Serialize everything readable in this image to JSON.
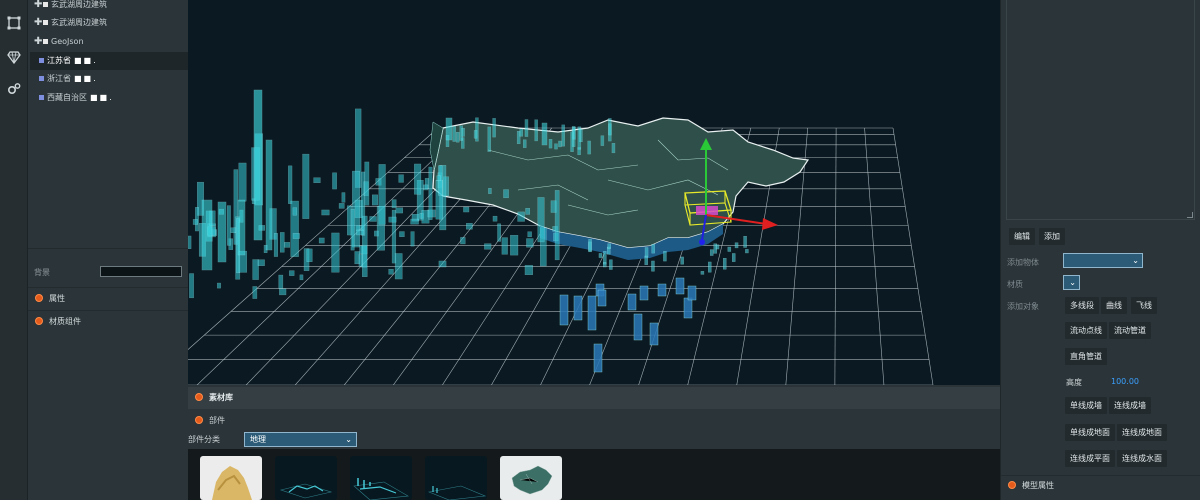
{
  "tree": {
    "items": [
      {
        "label": "玄武湖周边建筑",
        "expandable": true,
        "selected": false,
        "kind": "white"
      },
      {
        "label": "玄武湖周边建筑",
        "expandable": true,
        "selected": false,
        "kind": "white"
      },
      {
        "label": "GeoJson",
        "expandable": true,
        "selected": false,
        "kind": "white"
      },
      {
        "label": "江苏省",
        "expandable": false,
        "selected": true,
        "kind": "blue"
      },
      {
        "label": "浙江省",
        "expandable": false,
        "selected": false,
        "kind": "blue"
      },
      {
        "label": "西藏自治区",
        "expandable": false,
        "selected": false,
        "kind": "blue"
      }
    ]
  },
  "props": {
    "background_label": "背景",
    "background_color": "#0c1418",
    "sections": [
      "属性",
      "材质组件"
    ]
  },
  "library": {
    "title": "素材库",
    "parts_label": "部件",
    "category_label": "部件分类",
    "category_value": "地理"
  },
  "right": {
    "edit_label": "编辑",
    "add_label": "添加",
    "add_object_label": "添加物体",
    "add_object_value": "",
    "material_label": "材质",
    "add_target_label": "添加对象",
    "buttons_row1": [
      "多线段",
      "曲线",
      "飞线"
    ],
    "buttons_row2": [
      "流动点线",
      "流动管道"
    ],
    "buttons_row3": [
      "直角管道"
    ],
    "height_label": "高度",
    "height_value": "100.00",
    "buttons_row4": [
      "单线成墙",
      "连线成墙"
    ],
    "buttons_row5": [
      "单线成地面",
      "连线成地面"
    ],
    "buttons_row6": [
      "连线成平面",
      "连线成水面"
    ],
    "model_props_label": "模型属性"
  },
  "colors": {
    "accent_orange": "#e45b1c",
    "select_blue": "#2b5b76",
    "viewport_bg": "#0b1a22",
    "bar_cyan": "#3fe0e8",
    "bar_blue": "#2a78b8",
    "value_blue": "#3aa0ff"
  },
  "icons": [
    "frame-icon",
    "diamond-icon",
    "gears-icon",
    "plus-icon",
    "orange-circle-icon",
    "chevron-down-icon"
  ]
}
